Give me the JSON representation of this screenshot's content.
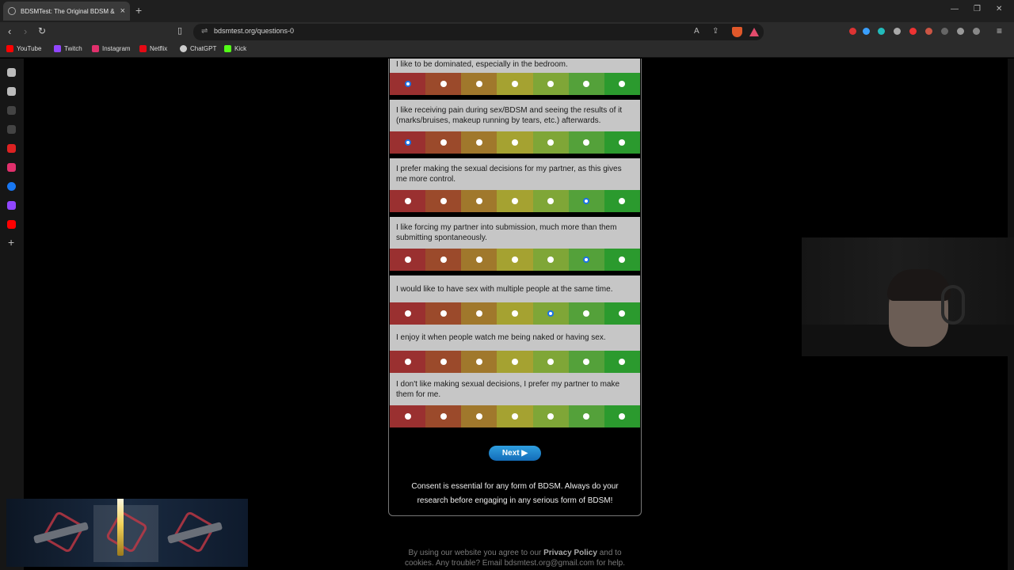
{
  "browser": {
    "tab_title": "BDSMTest: The Original BDSM &",
    "url": "bdsmtest.org/questions-0",
    "bookmarks": [
      {
        "label": "YouTube",
        "color": "#ff0000"
      },
      {
        "label": "Twitch",
        "color": "#9146ff"
      },
      {
        "label": "Instagram",
        "color": "#e1306c"
      },
      {
        "label": "Netflix",
        "color": "#e50914"
      },
      {
        "label": "ChatGPT",
        "color": "#cccccc"
      },
      {
        "label": "Kick",
        "color": "#53fc18"
      }
    ]
  },
  "quiz": {
    "questions": [
      {
        "text": "I like to be dominated, especially in the bedroom.",
        "selected": 0
      },
      {
        "text": "I like receiving pain during sex/BDSM and seeing the results of it (marks/bruises, makeup running by tears, etc.) afterwards.",
        "selected": 0
      },
      {
        "text": "I prefer making the sexual decisions for my partner, as this gives me more control.",
        "selected": 5
      },
      {
        "text": "I like forcing my partner into submission, much more than them submitting spontaneously.",
        "selected": 5
      },
      {
        "text": "I would like to have sex with multiple people at the same time.",
        "selected": 4
      },
      {
        "text": "I enjoy it when people watch me being naked or having sex.",
        "selected": null
      },
      {
        "text": "I don't like making sexual decisions, I prefer my partner to make them for me.",
        "selected": null
      }
    ],
    "next_label": "Next ▶",
    "consent": "Consent is essential for any form of BDSM. Always do your research before engaging in any serious form of BDSM!"
  },
  "footer": {
    "prefix": "By using our website you agree to our ",
    "policy_link": "Privacy Policy",
    "middle": " and to cookies. Any trouble? Email ",
    "email": "bdsmtest.org@gmail.com",
    "suffix": " for help."
  }
}
